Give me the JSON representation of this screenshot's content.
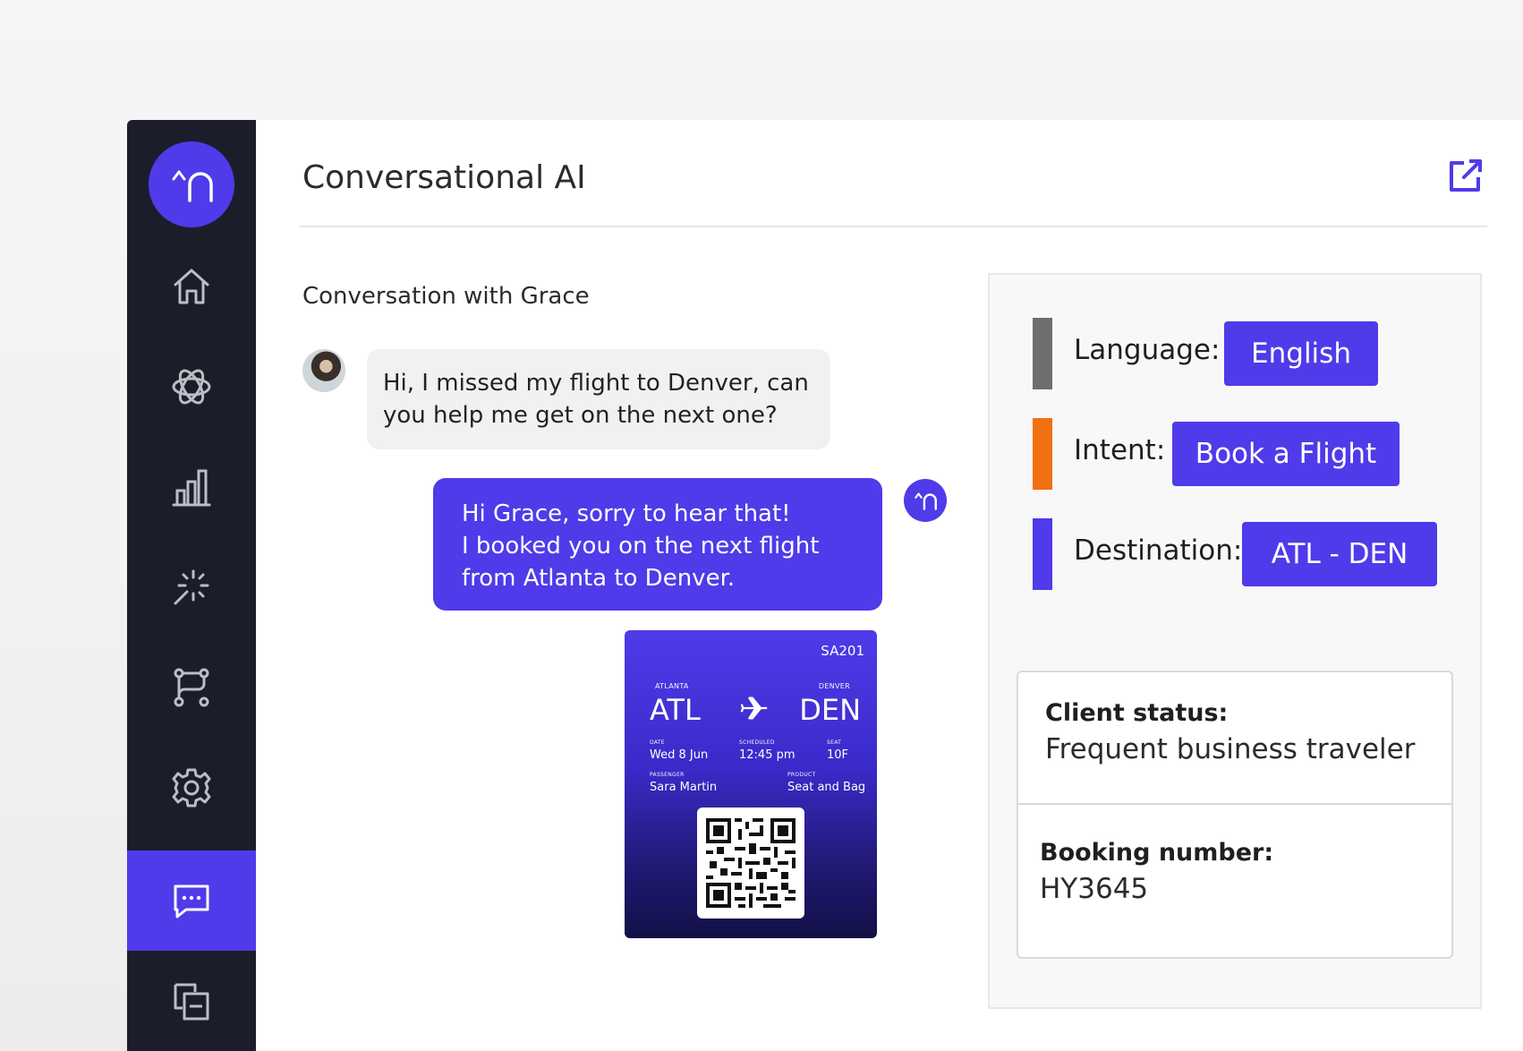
{
  "app": {
    "title": "Conversational AI",
    "logo_text": "^∩",
    "accent_color": "#4f3be9",
    "sidebar_color": "#1c1d2b"
  },
  "sidebar": {
    "items": [
      {
        "name": "home",
        "icon": "home-icon"
      },
      {
        "name": "ai",
        "icon": "atom-icon"
      },
      {
        "name": "analytics",
        "icon": "bar-chart-icon"
      },
      {
        "name": "insights",
        "icon": "sparkle-icon"
      },
      {
        "name": "flows",
        "icon": "workflow-icon"
      },
      {
        "name": "settings",
        "icon": "gear-icon"
      },
      {
        "name": "conversations",
        "icon": "chat-icon",
        "active": true
      },
      {
        "name": "documents",
        "icon": "copy-icon"
      }
    ]
  },
  "conversation": {
    "title": "Conversation with Grace",
    "user_message_line1": "Hi, I missed my flight to Denver, can",
    "user_message_line2": "you help me get on the next one?",
    "bot_message_line1": "Hi Grace, sorry to hear that!",
    "bot_message_line2": "I booked you on the next flight",
    "bot_message_line3": "from Atlanta to Denver.",
    "bot_avatar_text": "^∩"
  },
  "ticket": {
    "flight": "SA201",
    "origin_city": "ATLANTA",
    "origin_code": "ATL",
    "destination_city": "DENVER",
    "destination_code": "DEN",
    "date_label": "DATE",
    "date": "Wed 8 Jun",
    "scheduled_label": "SCHEDULED",
    "scheduled": "12:45 pm",
    "seat_label": "SEAT",
    "seat": "10F",
    "passenger_label": "PASSENGER",
    "passenger": "Sara Martin",
    "product_label": "PRODUCT",
    "product": "Seat and Bag"
  },
  "panel": {
    "attributes": [
      {
        "label": "Language:",
        "value": "English",
        "bar_color": "#6e6e6e"
      },
      {
        "label": "Intent:",
        "value": "Book a Flight",
        "bar_color": "#f07010"
      },
      {
        "label": "Destination:",
        "value": "ATL - DEN",
        "bar_color": "#4f3be9"
      }
    ],
    "client_status_label": "Client status:",
    "client_status_value": "Frequent business traveler",
    "booking_label": "Booking number:",
    "booking_value": "HY3645"
  }
}
